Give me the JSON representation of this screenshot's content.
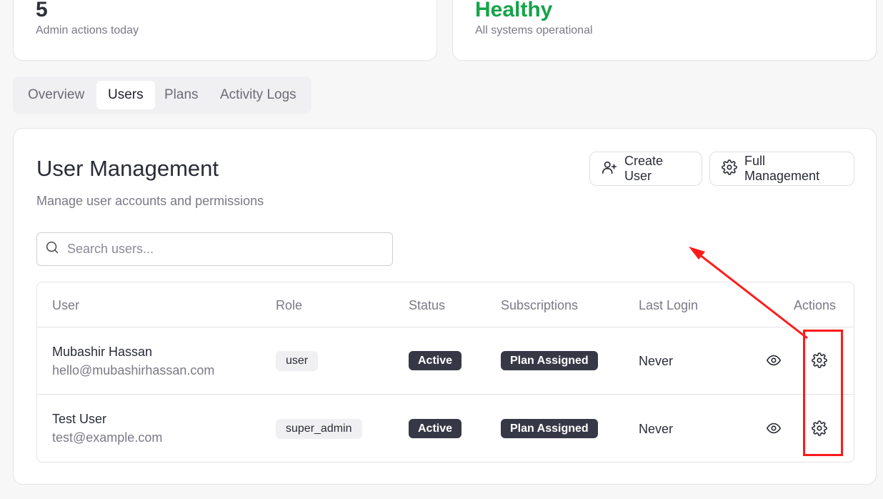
{
  "stats": [
    {
      "value": "5",
      "label": "Admin actions today"
    },
    {
      "value": "Healthy",
      "label": "All systems operational",
      "color": "#16a34a"
    }
  ],
  "tabs": [
    {
      "label": "Overview"
    },
    {
      "label": "Users",
      "active": true
    },
    {
      "label": "Plans"
    },
    {
      "label": "Activity Logs"
    }
  ],
  "panel": {
    "title": "User Management",
    "subtitle": "Manage user accounts and permissions",
    "create_button": "Create User",
    "full_button": "Full Management",
    "search_placeholder": "Search users..."
  },
  "table": {
    "headers": [
      "User",
      "Role",
      "Status",
      "Subscriptions",
      "Last Login",
      "Actions"
    ],
    "rows": [
      {
        "name": "Mubashir Hassan",
        "email": "hello@mubashirhassan.com",
        "role": "user",
        "status": "Active",
        "subscription": "Plan Assigned",
        "last_login": "Never"
      },
      {
        "name": "Test User",
        "email": "test@example.com",
        "role": "super_admin",
        "status": "Active",
        "subscription": "Plan Assigned",
        "last_login": "Never"
      }
    ]
  },
  "annotation_color": "#ff1a1a"
}
